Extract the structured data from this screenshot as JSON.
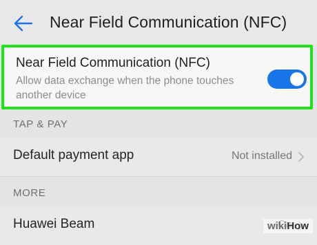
{
  "header": {
    "title": "Near Field Communication (NFC)",
    "back_icon": "back-arrow-icon"
  },
  "nfc": {
    "label": "Near Field Communication (NFC)",
    "description": "Allow data exchange when the phone touches another device",
    "enabled": true,
    "toggle_color": "#1976e8",
    "highlight_color": "#22e11a"
  },
  "sections": {
    "tap_pay": "TAP & PAY",
    "more": "MORE"
  },
  "rows": {
    "default_payment": {
      "label": "Default payment app",
      "value": "Not installed"
    },
    "huawei_beam": {
      "label": "Huawei Beam",
      "value": "On"
    }
  },
  "watermark": {
    "prefix": "wiki",
    "suffix": "How"
  }
}
